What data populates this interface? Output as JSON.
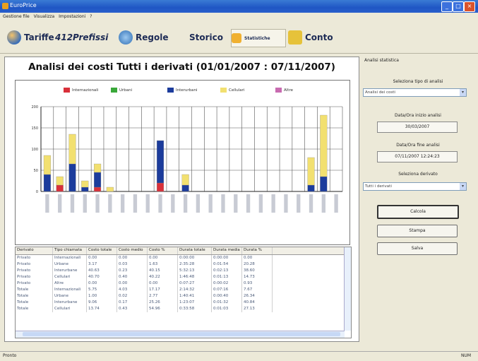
{
  "window": {
    "title": "EuroPrice"
  },
  "menu": [
    "Gestione file",
    "Visualizza",
    "Impostazioni",
    "?"
  ],
  "toolbar": {
    "items": [
      {
        "label": "Tariffe",
        "icon": "globe-icon"
      },
      {
        "label": "412Prefissi",
        "icon": "prefix-icon"
      },
      {
        "label": "Regole",
        "icon": "rules-icon"
      },
      {
        "label": "Storico",
        "icon": "history-icon"
      },
      {
        "label": "Statistiche",
        "icon": "statistics-icon"
      },
      {
        "label": "Conto",
        "icon": "account-icon"
      }
    ]
  },
  "main": {
    "heading": "Analisi dei costi Tutti i derivati (01/01/2007 : 07/11/2007)"
  },
  "chart_data": {
    "type": "bar",
    "stacked": true,
    "ylim": [
      0,
      200
    ],
    "yticks": [
      0,
      50,
      100,
      150,
      200
    ],
    "grid": true,
    "legend_position": "top",
    "series": [
      {
        "name": "Internazionali",
        "color": "#d9303a",
        "values": [
          0,
          15,
          0,
          0,
          10,
          0,
          0,
          0,
          0,
          20,
          0,
          0,
          0,
          0,
          0,
          0,
          0,
          0,
          0,
          0,
          0,
          0,
          0,
          0
        ]
      },
      {
        "name": "Urbani",
        "color": "#3aa83a",
        "values": [
          0,
          0,
          0,
          0,
          0,
          0,
          0,
          0,
          0,
          0,
          0,
          0,
          0,
          0,
          0,
          0,
          0,
          0,
          0,
          0,
          0,
          0,
          0,
          0
        ]
      },
      {
        "name": "Interurbani",
        "color": "#1c3c9c",
        "values": [
          40,
          0,
          65,
          10,
          35,
          0,
          0,
          0,
          0,
          100,
          0,
          15,
          0,
          0,
          0,
          0,
          0,
          0,
          0,
          0,
          0,
          15,
          35,
          0
        ]
      },
      {
        "name": "Cellulari",
        "color": "#f2e070",
        "values": [
          45,
          20,
          70,
          15,
          20,
          10,
          0,
          0,
          0,
          0,
          0,
          25,
          0,
          0,
          0,
          0,
          0,
          0,
          0,
          0,
          0,
          65,
          145,
          0
        ]
      },
      {
        "name": "Altre",
        "color": "#c86bb0",
        "values": [
          0,
          0,
          0,
          0,
          0,
          0,
          0,
          0,
          0,
          0,
          0,
          0,
          0,
          0,
          0,
          0,
          0,
          0,
          0,
          0,
          0,
          0,
          0,
          0
        ]
      }
    ]
  },
  "table": {
    "columns": [
      "Derivato",
      "Tipo chiamata",
      "Costo totale",
      "Costo medio",
      "Costo %",
      "Durata totale",
      "Durata media",
      "Durata %"
    ],
    "rows": [
      [
        "Privato",
        "Internazionali",
        "0.00",
        "0.00",
        "0.00",
        "0:00:00",
        "0:00:00",
        "0.00"
      ],
      [
        "Privato",
        "Urbane",
        "3.17",
        "0.03",
        "1.63",
        "2:35:28",
        "0:01:54",
        "20.28"
      ],
      [
        "Privato",
        "Interurbane",
        "40.63",
        "0.23",
        "40.15",
        "5:32:13",
        "0:02:13",
        "38.60"
      ],
      [
        "Privato",
        "Cellulari",
        "40.70",
        "0.40",
        "40.22",
        "1:46:48",
        "0:01:13",
        "14.73"
      ],
      [
        "Privato",
        "Altre",
        "0.00",
        "0.00",
        "0.00",
        "0:07:27",
        "0:00:02",
        "0.93"
      ],
      [
        "Totale",
        "Internazionali",
        "5.75",
        "4.03",
        "17.17",
        "2:14:32",
        "0:07:16",
        "7.67"
      ],
      [
        "Totale",
        "Urbane",
        "1.00",
        "0.02",
        "2.77",
        "1:40:41",
        "0:00:40",
        "26.34"
      ],
      [
        "Totale",
        "Interurbane",
        "9.06",
        "0.17",
        "25.26",
        "1:23:07",
        "0:01:32",
        "40.84"
      ],
      [
        "Totale",
        "Cellulari",
        "13.74",
        "0.43",
        "54.96",
        "0:33:58",
        "0:01:03",
        "27.13"
      ]
    ]
  },
  "side": {
    "title": "Analisi statistica",
    "type_label": "Seleziona tipo di analisi",
    "type_value": "Analisi dei costi",
    "start_label": "Data/Ora inizio analisi",
    "start_value": "30/03/2007",
    "end_label": "Data/Ora fine analisi",
    "end_value": "07/11/2007 12:24:23",
    "derived_label": "Seleziona derivato",
    "derived_value": "Tutti i derivati",
    "calc_button": "Calcola",
    "print_button": "Stampa",
    "save_button": "Salva"
  },
  "statusbar": {
    "left": "Pronto",
    "right": "NUM"
  }
}
